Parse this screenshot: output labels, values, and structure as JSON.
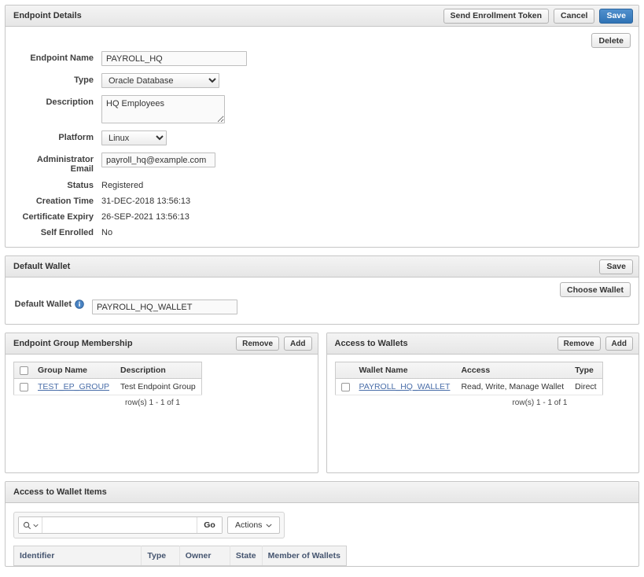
{
  "endpoint_details": {
    "title": "Endpoint Details",
    "buttons": {
      "send_token": "Send Enrollment Token",
      "cancel": "Cancel",
      "save": "Save",
      "delete": "Delete"
    },
    "fields": {
      "endpoint_name": {
        "label": "Endpoint Name",
        "value": "PAYROLL_HQ"
      },
      "type": {
        "label": "Type",
        "value": "Oracle Database"
      },
      "description": {
        "label": "Description",
        "value": "HQ Employees"
      },
      "platform": {
        "label": "Platform",
        "value": "Linux"
      },
      "administrator_email": {
        "label": "Administrator Email",
        "value": "payroll_hq@example.com"
      }
    },
    "readonly": [
      {
        "label": "Status",
        "value": "Registered"
      },
      {
        "label": "Creation Time",
        "value": "31-DEC-2018 13:56:13"
      },
      {
        "label": "Certificate Expiry",
        "value": "26-SEP-2021 13:56:13"
      },
      {
        "label": "Self Enrolled",
        "value": "No"
      }
    ]
  },
  "default_wallet": {
    "title": "Default Wallet",
    "save_label": "Save",
    "choose_label": "Choose Wallet",
    "field_label": "Default Wallet",
    "value": "PAYROLL_HQ_WALLET",
    "info_icon": "info-icon"
  },
  "endpoint_group_membership": {
    "title": "Endpoint Group Membership",
    "remove_label": "Remove",
    "add_label": "Add",
    "columns": [
      "Group Name",
      "Description"
    ],
    "rows": [
      {
        "group_name": "TEST_EP_GROUP",
        "description": "Test Endpoint Group"
      }
    ],
    "pagination": "row(s) 1 - 1 of 1"
  },
  "access_to_wallets": {
    "title": "Access to Wallets",
    "remove_label": "Remove",
    "add_label": "Add",
    "columns": [
      "Wallet Name",
      "Access",
      "Type"
    ],
    "rows": [
      {
        "wallet_name": "PAYROLL_HQ_WALLET",
        "access": "Read, Write, Manage Wallet",
        "type": "Direct"
      }
    ],
    "pagination": "row(s) 1 - 1 of 1"
  },
  "access_to_wallet_items": {
    "title": "Access to Wallet Items",
    "search": {
      "value": "",
      "placeholder": ""
    },
    "go_label": "Go",
    "actions_label": "Actions",
    "columns": [
      "Identifier",
      "Type",
      "Owner",
      "State",
      "Member of Wallets"
    ]
  },
  "colors": {
    "primary": "#2f73b5",
    "link": "#4a6ea9",
    "header_text": "#44546f",
    "border": "#c6c6c6"
  }
}
